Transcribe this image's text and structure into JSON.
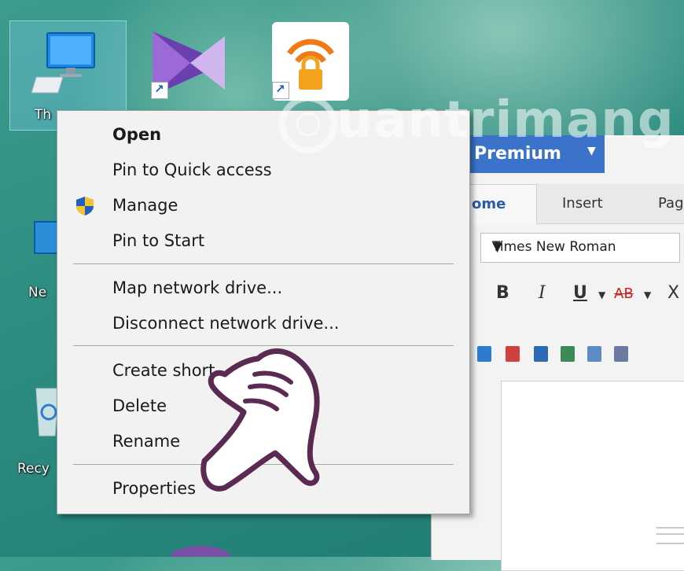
{
  "desktop": {
    "icons": [
      {
        "name": "this-pc",
        "label": "Th"
      },
      {
        "name": "network",
        "label": "Ne"
      },
      {
        "name": "recycle-bin",
        "label": "Recy"
      }
    ]
  },
  "word_window": {
    "title": "Premium",
    "tabs": [
      "ome",
      "Insert",
      "Pag"
    ],
    "font_name": "Times New Roman",
    "format_buttons": [
      "B",
      "I",
      "U",
      "AB",
      "X"
    ]
  },
  "context_menu": {
    "items": [
      {
        "label": "Open",
        "bold": true
      },
      {
        "label": "Pin to Quick access"
      },
      {
        "label": "Manage",
        "icon": "shield-icon"
      },
      {
        "label": "Pin to Start"
      },
      {
        "label": "Map network drive..."
      },
      {
        "label": "Disconnect network drive..."
      },
      {
        "label": "Create short"
      },
      {
        "label": "Delete"
      },
      {
        "label": "Rename"
      },
      {
        "label": "Properties"
      }
    ]
  },
  "watermark": {
    "text": "uantrimang"
  },
  "colors": {
    "desktop": "#2f8f82",
    "menu_bg": "#f2f2f2",
    "word_accent": "#3a73c9",
    "hand_outline": "#5b2a52"
  }
}
